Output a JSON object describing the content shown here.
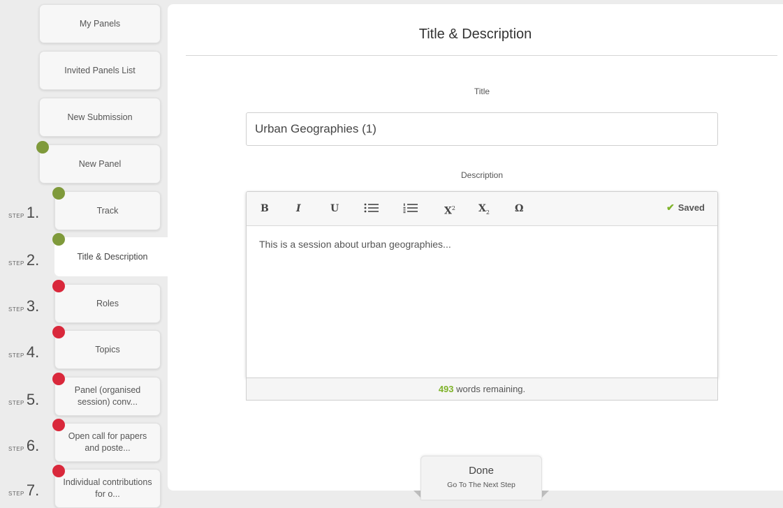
{
  "sidebar": {
    "top_items": [
      {
        "label": "My Panels"
      },
      {
        "label": "Invited Panels List"
      },
      {
        "label": "New Submission"
      },
      {
        "label": "New Panel",
        "status": "complete"
      }
    ],
    "step_word": "STEP",
    "steps": [
      {
        "num": "1.",
        "label": "Track",
        "status": "complete"
      },
      {
        "num": "2.",
        "label": "Title & Description",
        "status": "complete"
      },
      {
        "num": "3.",
        "label": "Roles",
        "status": "incomplete"
      },
      {
        "num": "4.",
        "label": "Topics",
        "status": "incomplete"
      },
      {
        "num": "5.",
        "label": "Panel (organised session) conv...",
        "status": "incomplete"
      },
      {
        "num": "6.",
        "label": "Open call for papers and poste...",
        "status": "incomplete"
      },
      {
        "num": "7.",
        "label": "Individual contributions for o...",
        "status": "incomplete"
      }
    ],
    "status_colors": {
      "complete": "#7f9a3b",
      "incomplete": "#d9283b"
    }
  },
  "main": {
    "heading": "Title & Description",
    "title_label": "Title",
    "title_value": "Urban Geographies (1)",
    "description_label": "Description",
    "toolbar": {
      "bold": "B",
      "italic": "I",
      "underline": "U",
      "bullet_list_icon": "bullet-list-icon",
      "numbered_list_icon": "numbered-list-icon",
      "superscript": "X",
      "superscript_mark": "2",
      "subscript": "X",
      "subscript_mark": "2",
      "special_char": "Ω",
      "saved_label": "Saved"
    },
    "description_text": "This is a session about urban geographies...",
    "words_remaining_count": "493",
    "words_remaining_suffix": "words remaining."
  },
  "footer": {
    "done_label": "Done",
    "done_sublabel": "Go To The Next Step"
  }
}
